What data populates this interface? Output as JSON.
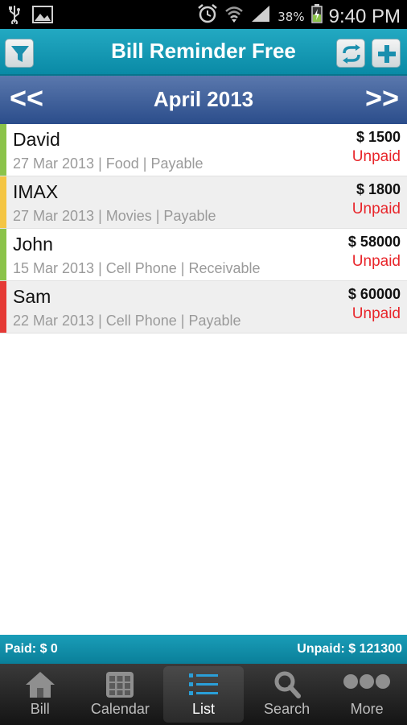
{
  "status_bar": {
    "icons": [
      "usb-icon",
      "image-icon",
      "alarm-icon",
      "wifi-icon",
      "signal-icon",
      "battery-icon"
    ],
    "battery": "38%",
    "time": "9:40 PM"
  },
  "header": {
    "title": "Bill Reminder Free",
    "filter_icon": "filter-icon",
    "refresh_icon": "refresh-icon",
    "add_icon": "plus-icon"
  },
  "month_nav": {
    "prev_label": "<<",
    "month": "April 2013",
    "next_label": ">>"
  },
  "bills": [
    {
      "name": "David",
      "meta": "27 Mar 2013 | Food | Payable",
      "amount": "$ 1500",
      "status": "Unpaid",
      "color": "#8bc34a"
    },
    {
      "name": "IMAX",
      "meta": "27 Mar 2013 | Movies | Payable",
      "amount": "$ 1800",
      "status": "Unpaid",
      "color": "#f4c542"
    },
    {
      "name": "John",
      "meta": "15 Mar 2013 | Cell Phone | Receivable",
      "amount": "$ 58000",
      "status": "Unpaid",
      "color": "#8bc34a"
    },
    {
      "name": "Sam",
      "meta": "22 Mar 2013 | Cell Phone | Payable",
      "amount": "$ 60000",
      "status": "Unpaid",
      "color": "#e53935"
    }
  ],
  "summary": {
    "paid": "Paid: $ 0",
    "unpaid": "Unpaid: $ 121300"
  },
  "bottom_nav": [
    {
      "label": "Bill",
      "icon": "home-icon",
      "active": false
    },
    {
      "label": "Calendar",
      "icon": "calendar-icon",
      "active": false
    },
    {
      "label": "List",
      "icon": "list-icon",
      "active": true
    },
    {
      "label": "Search",
      "icon": "search-icon",
      "active": false
    },
    {
      "label": "More",
      "icon": "more-icon",
      "active": false
    }
  ],
  "colors": {
    "header": "#1699b3",
    "month_bar": "#3d5e98",
    "unpaid": "#e8262b",
    "active_nav": "#2a9fd8"
  }
}
